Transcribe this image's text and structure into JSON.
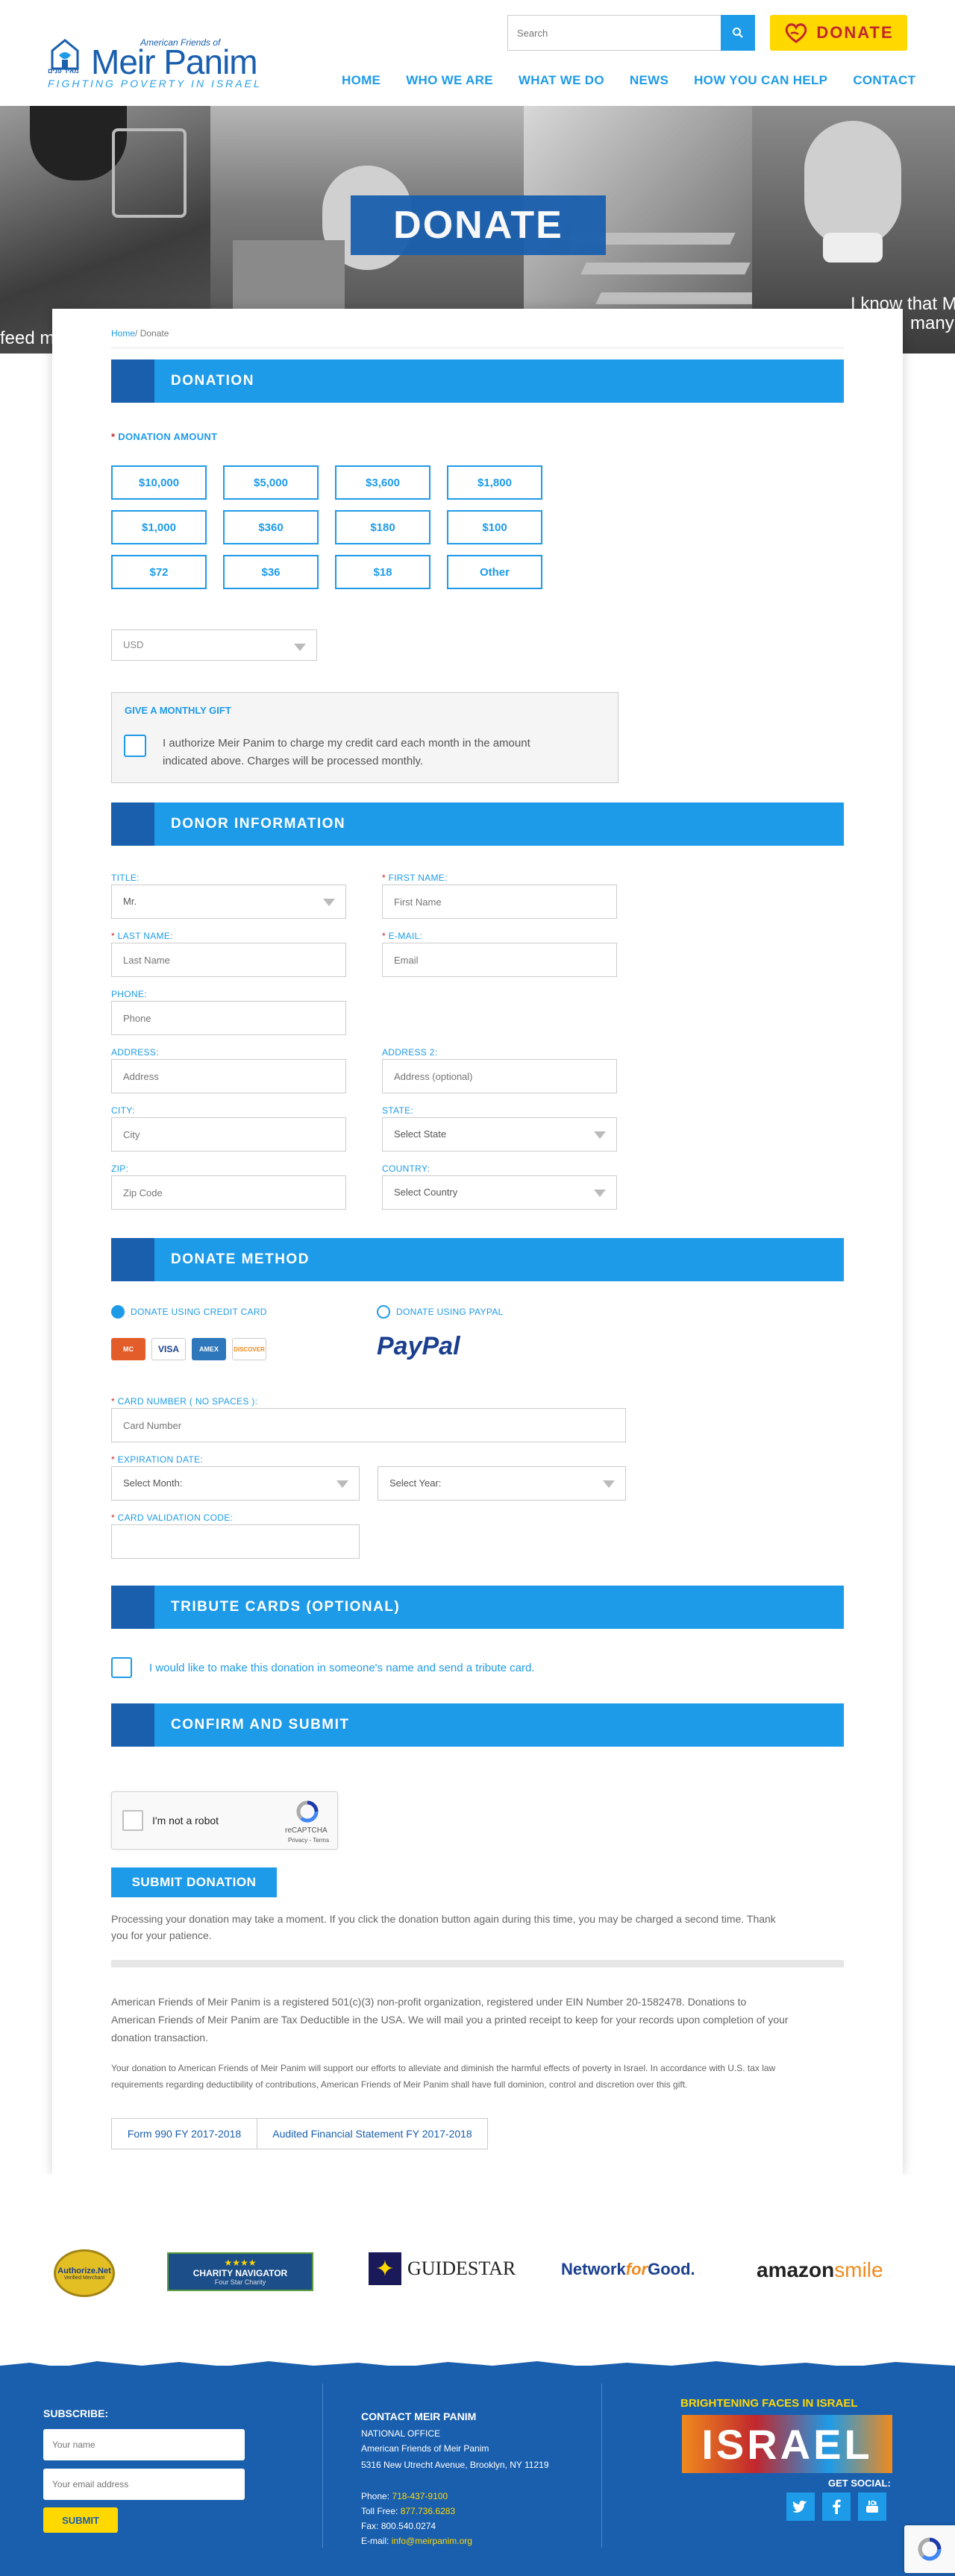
{
  "header": {
    "logo": {
      "top_line": "American Friends of",
      "name": "Meir Panim",
      "hebrew": "מאיר פנים",
      "tagline": "FIGHTING POVERTY IN ISRAEL"
    },
    "search_placeholder": "Search",
    "donate_label": "DONATE",
    "nav": [
      "HOME",
      "WHO WE ARE",
      "WHAT WE DO",
      "NEWS",
      "HOW YOU CAN HELP",
      "CONTACT"
    ]
  },
  "hero": {
    "title": "DONATE",
    "caption_left": "feed m",
    "caption_right_1": "I know that M",
    "caption_right_2": "many"
  },
  "breadcrumb": {
    "home": "Home",
    "sep": "/",
    "current": "Donate"
  },
  "donation": {
    "heading": "DONATION",
    "amount_label": "DONATION AMOUNT",
    "amounts": [
      "$10,000",
      "$5,000",
      "$3,600",
      "$1,800",
      "$1,000",
      "$360",
      "$180",
      "$100",
      "$72",
      "$36",
      "$18",
      "Other"
    ],
    "currency": "USD",
    "monthly_title": "GIVE A MONTHLY GIFT",
    "monthly_text_1": "I authorize Meir Panim to charge my credit card each month in the amount",
    "monthly_text_2": "indicated above. Charges will be processed monthly."
  },
  "donor": {
    "heading": "DONOR INFORMATION",
    "title_label": "TITLE:",
    "title_value": "Mr.",
    "first_label": "FIRST NAME:",
    "first_placeholder": "First Name",
    "last_label": "LAST NAME:",
    "last_placeholder": "Last Name",
    "email_label": "E-MAIL:",
    "email_placeholder": "Email",
    "phone_label": "PHONE:",
    "phone_placeholder": "Phone",
    "address_label": "ADDRESS:",
    "address_placeholder": "Address",
    "address2_label": "ADDRESS 2:",
    "address2_placeholder": "Address (optional)",
    "city_label": "CITY:",
    "city_placeholder": "City",
    "state_label": "STATE:",
    "state_value": "Select State",
    "zip_label": "ZIP:",
    "zip_placeholder": "Zip Code",
    "country_label": "COUNTRY:",
    "country_value": "Select Country"
  },
  "method": {
    "heading": "DONATE METHOD",
    "credit_label": "DONATE USING CREDIT CARD",
    "paypal_label": "DONATE USING PAYPAL",
    "paypal_logo": "PayPal",
    "cards": [
      {
        "name": "mastercard",
        "text": "MC",
        "color": "#e35d2a"
      },
      {
        "name": "visa",
        "text": "VISA",
        "color": "#1a3f8f"
      },
      {
        "name": "amex",
        "text": "AMEX",
        "color": "#2e77bb"
      },
      {
        "name": "discover",
        "text": "DISCOVER",
        "color": "#f08a1d"
      }
    ],
    "card_number_label": "CARD NUMBER ( NO SPACES ):",
    "card_number_placeholder": "Card Number",
    "expiration_label": "EXPIRATION DATE:",
    "month_value": "Select Month:",
    "year_value": "Select Year:",
    "cvc_label": "CARD VALIDATION CODE:"
  },
  "tribute": {
    "heading": "TRIBUTE CARDS (OPTIONAL)",
    "text": "I would like to make this donation in someone's name and send a tribute card."
  },
  "confirm": {
    "heading": "CONFIRM AND SUBMIT",
    "captcha_text": "I'm not a robot",
    "captcha_brand": "reCAPTCHA",
    "captcha_links": "Privacy - Terms",
    "submit_label": "SUBMIT DONATION",
    "notice_1": "Processing your donation may take a moment. If you click the donation button again during this time, you may be charged a second time. Thank",
    "notice_2": "you for your patience."
  },
  "legal": {
    "p1_1": "American Friends of Meir Panim is a registered 501(c)(3) non-profit organization, registered under EIN Number 20-1582478. Donations to",
    "p1_2": "American Friends of Meir Panim are Tax Deductible in the USA. We will mail you a printed receipt to keep for your records upon completion of your",
    "p1_3": "donation transaction.",
    "p2_1": "Your donation to American Friends of Meir Panim will support our efforts to alleviate and diminish the harmful effects of poverty in Israel. In accordance with U.S. tax law",
    "p2_2": "requirements regarding deductibility of contributions, American Friends of Meir Panim shall have full dominion, control and discretion over this gift.",
    "form990": "Form 990 FY 2017-2018",
    "audit": "Audited Financial Statement FY 2017-2018"
  },
  "sponsors": {
    "authorize": "Authorize.Net",
    "authorize_sub": "Verified Merchant",
    "charity_stars": "★★★★",
    "charity_name": "CHARITY NAVIGATOR",
    "charity_sub": "Four Star Charity",
    "guidestar": "GUIDESTAR",
    "network_a": "Network",
    "network_b": "for",
    "network_c": "Good.",
    "amazon_a": "amazon",
    "amazon_b": "smile"
  },
  "footer": {
    "subscribe_label": "SUBSCRIBE:",
    "name_placeholder": "Your name",
    "email_placeholder": "Your email address",
    "submit_label": "SUBMIT",
    "contact_title": "CONTACT MEIR PANIM",
    "office": "NATIONAL OFFICE",
    "org": "American Friends of Meir Panim",
    "address": "5316 New Utrecht Avenue, Brooklyn, NY 11219",
    "phone_label": "Phone:",
    "phone": "718-437-9100",
    "tollfree_label": "Toll Free:",
    "tollfree": "877.736.6283",
    "fax_label": "Fax:",
    "fax": "800.540.0274",
    "email_label": "E-mail:",
    "email": "info@meirpanim.org",
    "brightening": "BRIGHTENING FACES IN ISRAEL",
    "israel": "ISRAEL",
    "get_social": "GET SOCIAL:"
  },
  "colors": {
    "primary": "#1e9be8",
    "dark": "#1a5fae",
    "yellow": "#ffd800",
    "red": "#c1272d"
  }
}
